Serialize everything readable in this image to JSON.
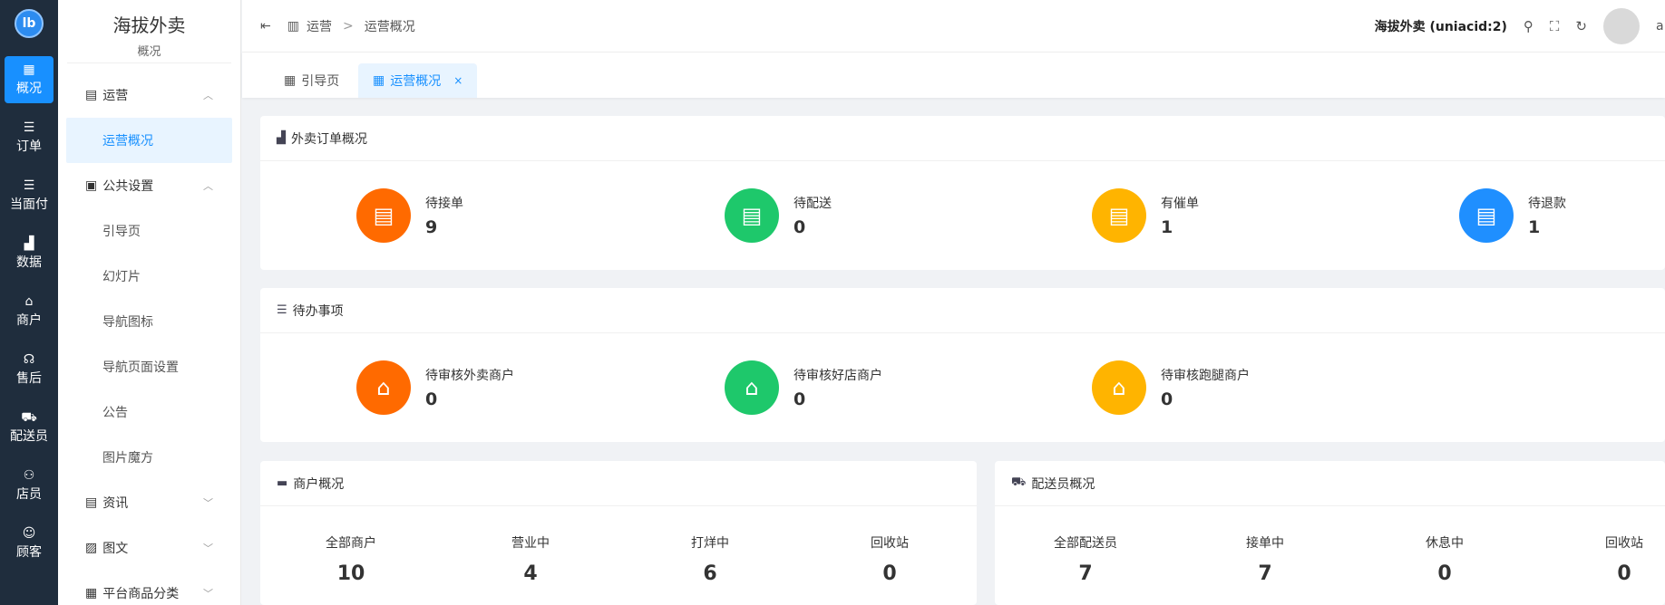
{
  "rail": {
    "logo": "lb",
    "items": [
      {
        "label": "概况",
        "icon": "grid-icon",
        "glyph": "▦"
      },
      {
        "label": "订单",
        "icon": "list-icon",
        "glyph": "☰"
      },
      {
        "label": "当面付",
        "icon": "list-icon",
        "glyph": "☰"
      },
      {
        "label": "数据",
        "icon": "bar-chart-icon",
        "glyph": "▟"
      },
      {
        "label": "商户",
        "icon": "store-icon",
        "glyph": "⌂"
      },
      {
        "label": "售后",
        "icon": "headset-icon",
        "glyph": "☊"
      },
      {
        "label": "配送员",
        "icon": "delivery-icon",
        "glyph": "⛟"
      },
      {
        "label": "店员",
        "icon": "users-icon",
        "glyph": "⚇"
      },
      {
        "label": "顾客",
        "icon": "user-circle-icon",
        "glyph": "☺"
      }
    ]
  },
  "sidebar": {
    "brand_name": "海拔外卖",
    "brand_sub": "概况",
    "groups": [
      {
        "label": "运营",
        "glyph": "▤"
      },
      {
        "label": "公共设置",
        "glyph": "▣"
      },
      {
        "label": "资讯",
        "glyph": "▤"
      },
      {
        "label": "图文",
        "glyph": "▨"
      },
      {
        "label": "平台商品分类",
        "glyph": "▦"
      }
    ],
    "items": [
      "运营概况",
      "引导页",
      "幻灯片",
      "导航图标",
      "导航页面设置",
      "公告",
      "图片魔方"
    ]
  },
  "header": {
    "collapse_glyph": "⇤",
    "breadcrumb": [
      "运营",
      "运营概况"
    ],
    "sep": ">",
    "title": "海拔外卖 (uniacid:2)",
    "user": "a"
  },
  "tabs": [
    {
      "label": "引导页"
    },
    {
      "label": "运营概况",
      "close": "×"
    }
  ],
  "orders": {
    "title": "外卖订单概况",
    "stats": [
      {
        "label": "待接单",
        "value": "9",
        "color": "#ff6a00"
      },
      {
        "label": "待配送",
        "value": "0",
        "color": "#1ec86b"
      },
      {
        "label": "有催单",
        "value": "1",
        "color": "#ffb400"
      },
      {
        "label": "待退款",
        "value": "1",
        "color": "#1f8fff"
      }
    ]
  },
  "todo": {
    "title": "待办事项",
    "stats": [
      {
        "label": "待审核外卖商户",
        "value": "0",
        "color": "#ff6a00"
      },
      {
        "label": "待审核好店商户",
        "value": "0",
        "color": "#1ec86b"
      },
      {
        "label": "待审核跑腿商户",
        "value": "0",
        "color": "#ffb400"
      }
    ]
  },
  "merchants": {
    "title": "商户概况",
    "cells": [
      {
        "label": "全部商户",
        "value": "10"
      },
      {
        "label": "营业中",
        "value": "4"
      },
      {
        "label": "打烊中",
        "value": "6"
      },
      {
        "label": "回收站",
        "value": "0"
      }
    ]
  },
  "riders": {
    "title": "配送员概况",
    "cells": [
      {
        "label": "全部配送员",
        "value": "7"
      },
      {
        "label": "接单中",
        "value": "7"
      },
      {
        "label": "休息中",
        "value": "0"
      },
      {
        "label": "回收站",
        "value": "0"
      }
    ]
  }
}
